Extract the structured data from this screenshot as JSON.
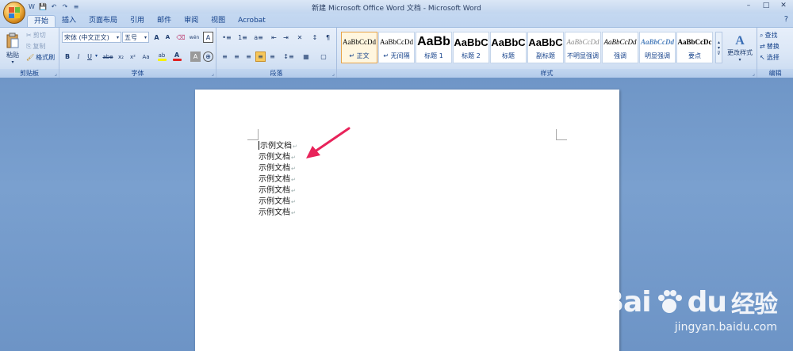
{
  "window": {
    "title": "新建 Microsoft Office Word 文档 - Microsoft Word",
    "qat": [
      "W",
      "💾",
      "↶",
      "↷",
      "≡"
    ],
    "controls": [
      "–",
      "□",
      "✕"
    ]
  },
  "tabs": [
    "开始",
    "插入",
    "页面布局",
    "引用",
    "邮件",
    "审阅",
    "视图",
    "Acrobat"
  ],
  "help_icon": "?",
  "clipboard": {
    "paste": "粘贴",
    "cut": "剪切",
    "copy": "复制",
    "format_painter": "格式刷",
    "label": "剪贴板"
  },
  "font": {
    "font_name": "宋体 (中文正文)",
    "font_size": "五号",
    "grow": "A",
    "shrink": "A",
    "clear": "⌫",
    "phonetic": "wén",
    "border_char": "A",
    "bold": "B",
    "italic": "I",
    "underline": "U",
    "strike": "abe",
    "subscript": "x₂",
    "superscript": "x²",
    "change_case": "Aa",
    "highlight": "ab",
    "font_color": "A",
    "shade_char": "A",
    "enclose": "⊕",
    "label": "字体",
    "highlight_color": "#f7f200",
    "font_color_value": "#e02020"
  },
  "paragraph": {
    "label": "段落",
    "row1": [
      "•≡",
      "1≡",
      "a≡",
      "⇤",
      "⇥",
      "✕",
      "↕",
      "¶"
    ],
    "row2": [
      "≡",
      "≡",
      "≡",
      "≡",
      "≡",
      "↕≡",
      "▦",
      "▢"
    ]
  },
  "styles": {
    "label": "样式",
    "items": [
      {
        "sample": "AaBbCcDd",
        "name": "↵ 正文"
      },
      {
        "sample": "AaBbCcDd",
        "name": "↵ 无间隔"
      },
      {
        "sample": "AaBb",
        "name": "标题 1"
      },
      {
        "sample": "AaBbC",
        "name": "标题 2"
      },
      {
        "sample": "AaBbC",
        "name": "标题"
      },
      {
        "sample": "AaBbC",
        "name": "副标题"
      },
      {
        "sample": "AaBbCcDd",
        "name": "不明显强调"
      },
      {
        "sample": "AaBbCcDd",
        "name": "强调"
      },
      {
        "sample": "AaBbCcDd",
        "name": "明显强调"
      },
      {
        "sample": "AaBbCcDc",
        "name": "要点"
      }
    ],
    "change_styles": "更改样式"
  },
  "editing": {
    "label": "编辑",
    "find": "查找",
    "replace": "替换",
    "select": "选择"
  },
  "document": {
    "lines": [
      "示例文档",
      "示例文档",
      "示例文档",
      "示例文档",
      "示例文档",
      "示例文档",
      "示例文档"
    ],
    "para_mark": "↵"
  },
  "watermark": {
    "brand": "Bai",
    "brand2": "du",
    "brand_cn": "经验",
    "url": "jingyan.baidu.com"
  },
  "colors": {
    "arrow": "#e8235a",
    "ribbon": "#dae6f6",
    "background": "#7aa0cf"
  }
}
